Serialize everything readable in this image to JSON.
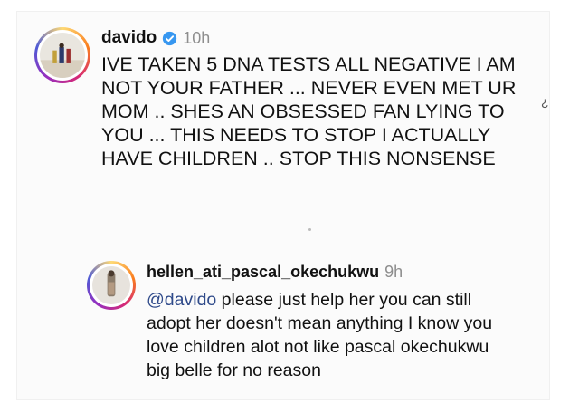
{
  "main_comment": {
    "username": "davido",
    "time": "10h",
    "verified": true,
    "text": "IVE TAKEN 5 DNA TESTS ALL NEGATIVE  I AM NOT YOUR FATHER ... NEVER EVEN MET UR MOM .. SHES AN OBSESSED FAN LYING TO YOU ... THIS NEEDS TO STOP I ACTUALLY HAVE CHILDREN .. STOP THIS NONSENSE"
  },
  "reply_comment": {
    "username": "hellen_ati_pascal_okechukwu",
    "time": "9h",
    "mention": "@davido",
    "text": " please just help her you can still adopt her doesn't mean anything I know you love children alot not like pascal okechukwu big belle for no reason"
  },
  "colors": {
    "mention": "#2f4a8a",
    "verified": "#3797f0",
    "timestamp": "#8e8e8e"
  }
}
